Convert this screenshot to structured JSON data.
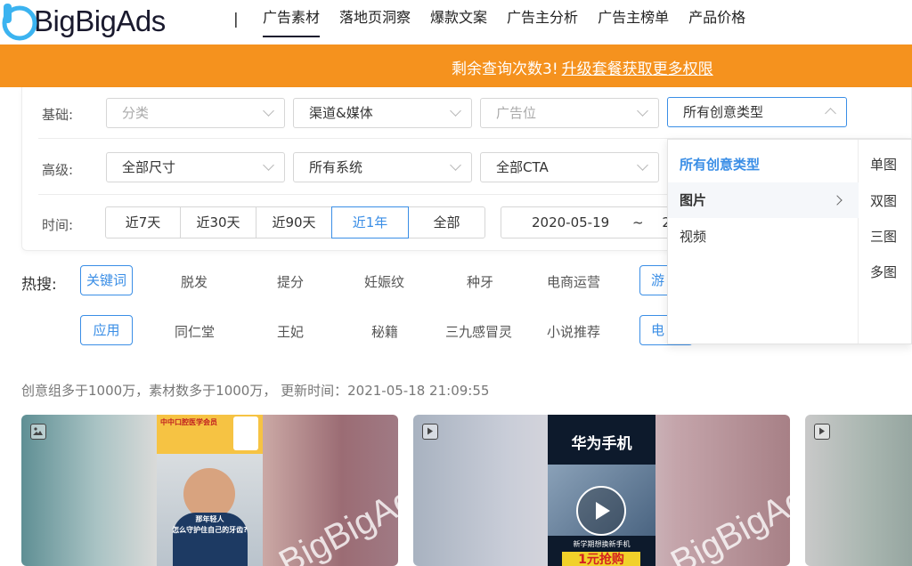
{
  "header": {
    "logo_text": "BigBigAds",
    "divider": "|",
    "nav": [
      "广告素材",
      "落地页洞察",
      "爆款文案",
      "广告主分析",
      "广告主榜单",
      "产品价格"
    ]
  },
  "banner": {
    "text": "剩余查询次数3!",
    "link": "升级套餐获取更多权限"
  },
  "filters": {
    "basic_label": "基础:",
    "advanced_label": "高级:",
    "time_label": "时间:",
    "basic": {
      "category": "分类",
      "channel": "渠道&媒体",
      "placement": "广告位",
      "creative_type": "所有创意类型"
    },
    "advanced": {
      "size": "全部尺寸",
      "os": "所有系统",
      "cta": "全部CTA"
    },
    "time_options": [
      "近7天",
      "近30天",
      "近90天",
      "近1年",
      "全部"
    ],
    "time_active": "近1年",
    "date_start": "2020-05-19",
    "date_sep": "~",
    "date_end_partial": "2"
  },
  "dropdown": {
    "items": [
      "所有创意类型",
      "图片",
      "视频"
    ],
    "selected": "所有创意类型",
    "hover": "图片",
    "sub_items": [
      "单图",
      "双图",
      "三图",
      "多图"
    ]
  },
  "hot": {
    "label": "热搜:",
    "row1_tag": "关键词",
    "row1_keywords": [
      "脱发",
      "提分",
      "妊娠纹",
      "种牙",
      "电商运营"
    ],
    "row1_right_tag": "游",
    "row2_tag": "应用",
    "row2_keywords": [
      "同仁堂",
      "王妃",
      "秘籍",
      "三九感冒灵",
      "小说推荐"
    ],
    "row2_right_tag": "电"
  },
  "stats_text": "创意组多于1000万，素材数多于1000万， 更新时间：2021-05-18 21:09:55",
  "cards": [
    {
      "type_icon": "image-icon",
      "thumb_text": [
        "中中口腔医学会员",
        "那年轻人",
        "怎么守护住自己的牙齿?"
      ],
      "watermark": "BigBigAds"
    },
    {
      "type_icon": "video-icon",
      "thumb_text": [
        "华为手机",
        "新学期想换新手机",
        "1元抢购"
      ],
      "watermark": "BigBigAds"
    },
    {
      "type_icon": "video-icon"
    }
  ]
}
